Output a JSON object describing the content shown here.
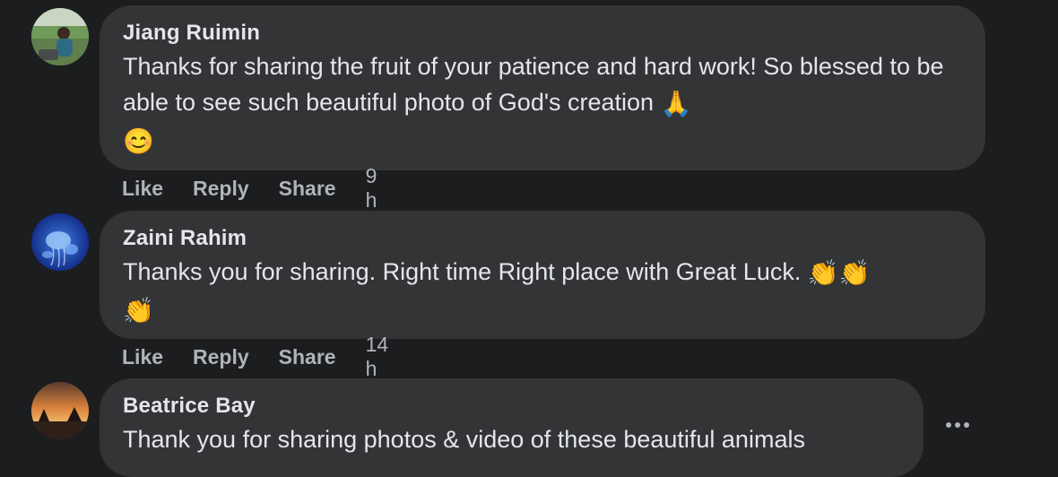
{
  "comments": [
    {
      "author": "Jiang Ruimin",
      "text": "Thanks for sharing the fruit of your patience and hard work! So blessed to be able to see such beautiful photo of God's creation",
      "emoji_1": "🙏",
      "emoji_2": "😊",
      "actions": {
        "like": "Like",
        "reply": "Reply",
        "share": "Share"
      },
      "time": "9 h",
      "avatar_icon": "avatar-photo-child-park"
    },
    {
      "author": "Zaini Rahim",
      "text": "Thanks you for sharing. Right time Right place with Great Luck.",
      "emoji_1": "👏",
      "emoji_2": "👏",
      "emoji_3": "👏",
      "actions": {
        "like": "Like",
        "reply": "Reply",
        "share": "Share"
      },
      "time": "14 h",
      "avatar_icon": "avatar-photo-jellyfish"
    },
    {
      "author": "Beatrice Bay",
      "text": "Thank you for sharing photos & video of these beautiful animals",
      "avatar_icon": "avatar-photo-sunset"
    }
  ],
  "colors": {
    "background": "#1c1d1f",
    "bubble": "#333436",
    "primary_text": "#e4e6eb",
    "secondary_text": "#b0b3b8"
  }
}
